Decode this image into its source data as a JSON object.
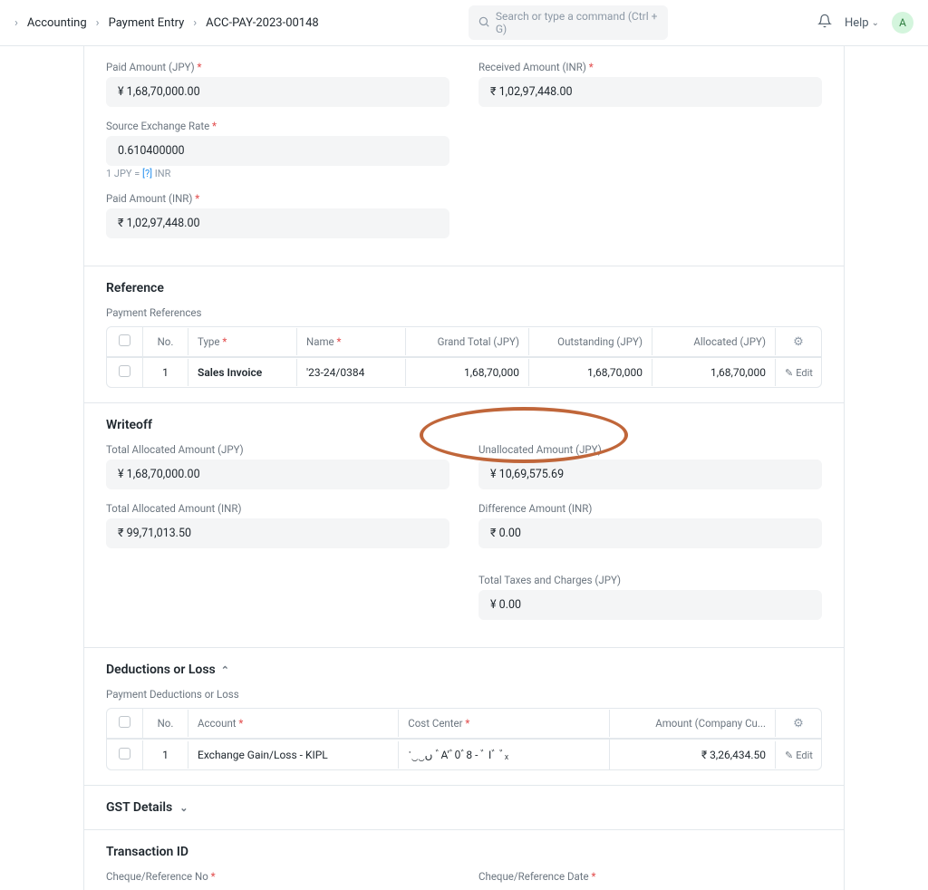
{
  "header": {
    "breadcrumb": [
      "Accounting",
      "Payment Entry",
      "ACC-PAY-2023-00148"
    ],
    "search_placeholder": "Search or type a command (Ctrl + G)",
    "help_label": "Help",
    "avatar_initial": "A"
  },
  "amounts": {
    "paid_jpy_label": "Paid Amount (JPY)",
    "paid_jpy_value": "¥ 1,68,70,000.00",
    "received_inr_label": "Received Amount (INR)",
    "received_inr_value": "₹ 1,02,97,448.00",
    "src_rate_label": "Source Exchange Rate",
    "src_rate_value": "0.610400000",
    "rate_hint_prefix": "1 JPY = ",
    "rate_hint_link": "[?]",
    "rate_hint_suffix": " INR",
    "paid_inr_label": "Paid Amount (INR)",
    "paid_inr_value": "₹ 1,02,97,448.00"
  },
  "reference": {
    "title": "Reference",
    "subtitle": "Payment References",
    "headers": {
      "no": "No.",
      "type": "Type",
      "name": "Name",
      "grand_total": "Grand Total (JPY)",
      "outstanding": "Outstanding (JPY)",
      "allocated": "Allocated (JPY)"
    },
    "row": {
      "no": "1",
      "type": "Sales Invoice",
      "name": "'23-24/0384",
      "grand_total": "1,68,70,000",
      "outstanding": "1,68,70,000",
      "allocated": "1,68,70,000",
      "edit": "Edit"
    }
  },
  "writeoff": {
    "title": "Writeoff",
    "alloc_jpy_label": "Total Allocated Amount (JPY)",
    "alloc_jpy_value": "¥ 1,68,70,000.00",
    "unalloc_jpy_label": "Unallocated Amount (JPY)",
    "unalloc_jpy_value": "¥ 10,69,575.69",
    "alloc_inr_label": "Total Allocated Amount (INR)",
    "alloc_inr_value": "₹ 99,71,013.50",
    "diff_inr_label": "Difference Amount (INR)",
    "diff_inr_value": "₹ 0.00",
    "tax_label": "Total Taxes and Charges (JPY)",
    "tax_value": "¥ 0.00"
  },
  "deductions": {
    "title": "Deductions or Loss",
    "subtitle": "Payment Deductions or Loss",
    "headers": {
      "no": "No.",
      "account": "Account",
      "cost_center": "Cost Center",
      "amount": "Amount (Company Cu..."
    },
    "row": {
      "no": "1",
      "account": "Exchange Gain/Loss - KIPL",
      "cost_center": "ॱ‿‿ﮞ  ﾞA'ﾞ0ﾞ8 - ﾞ Iﾞ ﾞₓ",
      "amount": "₹ 3,26,434.50",
      "edit": "Edit"
    }
  },
  "gst": {
    "title": "GST Details"
  },
  "transaction": {
    "title": "Transaction ID",
    "cheque_no_label": "Cheque/Reference No",
    "cheque_date_label": "Cheque/Reference Date"
  }
}
